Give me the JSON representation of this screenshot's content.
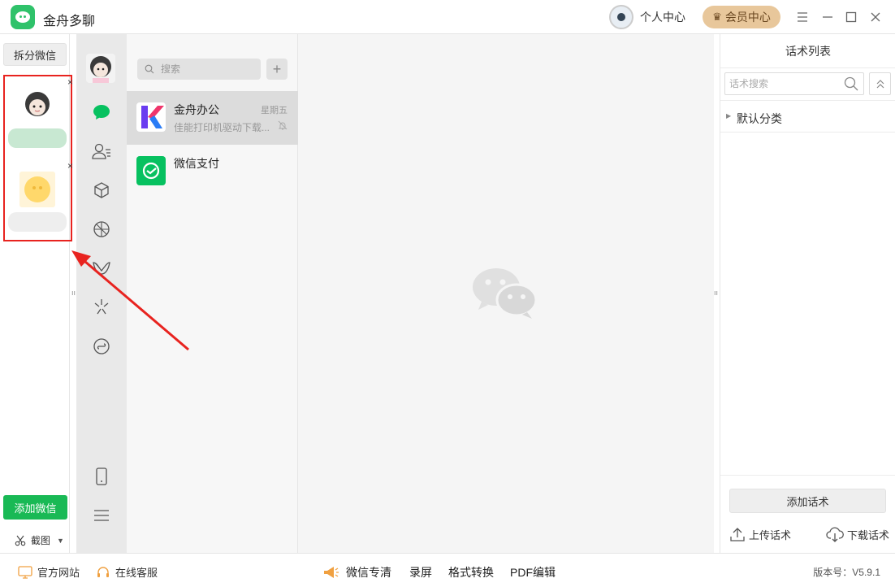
{
  "titlebar": {
    "app_title": "金舟多聊",
    "personal_center": "个人中心",
    "vip_center": "会员中心",
    "menu_icon": "hamburger-icon",
    "minimize_icon": "minimize-icon",
    "maximize_icon": "maximize-icon",
    "close_icon": "close-icon"
  },
  "accounts": {
    "split_button": "拆分微信",
    "close_mark": "×",
    "add_button": "添加微信",
    "screenshot_label": "截图",
    "screenshot_icon": "scissors-icon"
  },
  "wechat_sidebar": {
    "icons": [
      "chat-icon",
      "contacts-icon",
      "favorites-icon",
      "moments-icon",
      "channels-icon",
      "search-discover-icon",
      "mini-program-icon",
      "phone-icon",
      "more-menu-icon"
    ],
    "accent": "#07c160"
  },
  "conversation": {
    "search_placeholder": "搜索",
    "add_symbol": "+",
    "chats": [
      {
        "name": "金舟办公",
        "time": "星期五",
        "preview": "佳能打印机驱动下载..."
      },
      {
        "name": "微信支付",
        "time": "",
        "preview": ""
      }
    ]
  },
  "right_panel": {
    "title": "话术列表",
    "search_placeholder": "话术搜索",
    "category": "默认分类",
    "add_button": "添加话术",
    "upload": "上传话术",
    "download": "下载话术"
  },
  "statusbar": {
    "official_site": "官方网站",
    "online_service": "在线客服",
    "wechat_hd": "微信专清",
    "record": "录屏",
    "format_convert": "格式转换",
    "pdf_edit": "PDF编辑",
    "version": "版本号：V5.9.1"
  },
  "colors": {
    "brand_green": "#19b955",
    "vip_gold": "#e8c79b",
    "highlight_red": "#e8231f"
  }
}
